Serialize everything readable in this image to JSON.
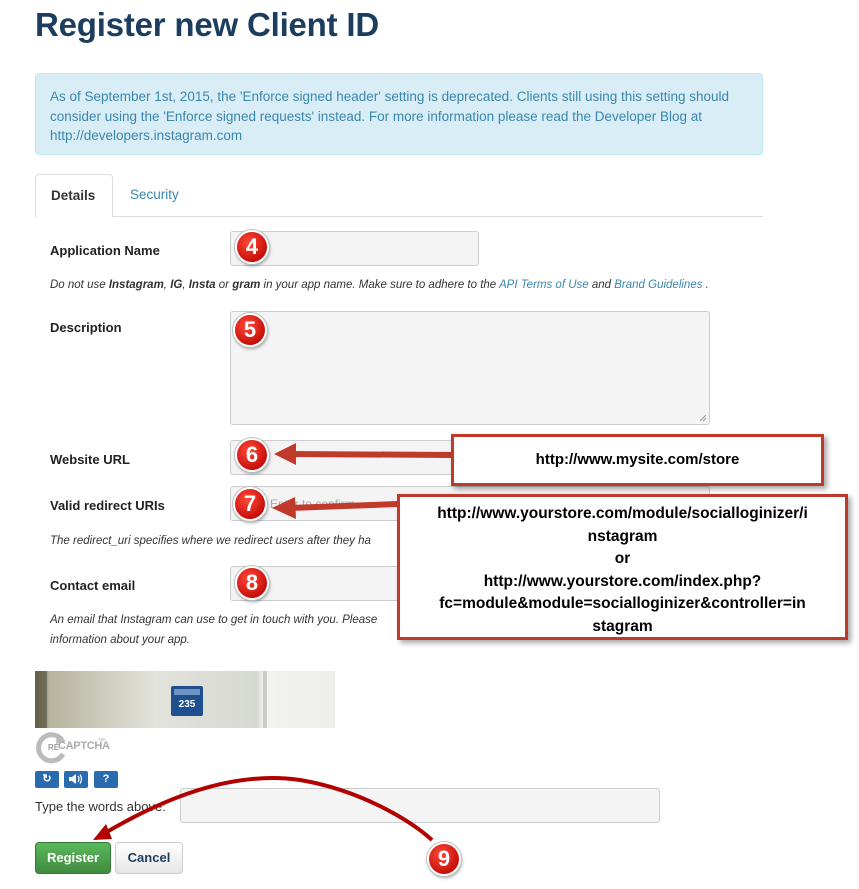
{
  "page": {
    "title": "Register new Client ID"
  },
  "alert": {
    "text": "As of September 1st, 2015, the 'Enforce signed header' setting is deprecated. Clients still using this setting should consider using the 'Enforce signed requests' instead. For more information please read the Developer Blog at http://developers.instagram.com"
  },
  "tabs": [
    {
      "label": "Details",
      "active": true
    },
    {
      "label": "Security",
      "active": false
    }
  ],
  "form": {
    "app_name": {
      "label": "Application Name",
      "help_prefix": "Do not use ",
      "help_w1": "Instagram",
      "help_sep1": ", ",
      "help_w2": "IG",
      "help_sep2": ", ",
      "help_w3": "Insta",
      "help_or": " or ",
      "help_w4": "gram",
      "help_mid": " in your app name. Make sure to adhere to the ",
      "help_link1": "API Terms of Use",
      "help_and": " and ",
      "help_link2": "Brand Guidelines",
      "help_end": " ."
    },
    "description": {
      "label": "Description"
    },
    "website_url": {
      "label": "Website URL"
    },
    "redirect_uris": {
      "label": "Valid redirect URIs",
      "placeholder_visible": "Enter to confirm",
      "help": "The redirect_uri specifies where we redirect users after they ha"
    },
    "contact_email": {
      "label": "Contact email",
      "help_line1": "An email that Instagram can use to get in touch with you. Please",
      "help_line2": "information about your app."
    }
  },
  "captcha": {
    "logo_text": "reCAPTCHA™",
    "logo_prefix": "RE",
    "logo_main": "CAPTCHA",
    "logo_tm": "™",
    "house_number": "235",
    "reload_icon": "↻",
    "audio_icon": "🔊",
    "help_icon": "?",
    "prompt": "Type the words above:"
  },
  "buttons": {
    "register": "Register",
    "cancel": "Cancel"
  },
  "annotations": {
    "badges": [
      "4",
      "5",
      "6",
      "7",
      "8",
      "9"
    ],
    "website_callout": "http://www.mysite.com/store",
    "redirect_callout": [
      "http://www.yourstore.com/module/socialloginizer/i",
      "nstagram",
      "or",
      "http://www.yourstore.com/index.php?",
      "fc=module&module=socialloginizer&controller=in",
      "stagram"
    ]
  },
  "colors": {
    "title": "#1c3d5e",
    "alert_bg": "#d9edf7",
    "alert_text": "#3a87ad",
    "annotation_red": "#c0392b",
    "register_green": "#5cb85c"
  }
}
